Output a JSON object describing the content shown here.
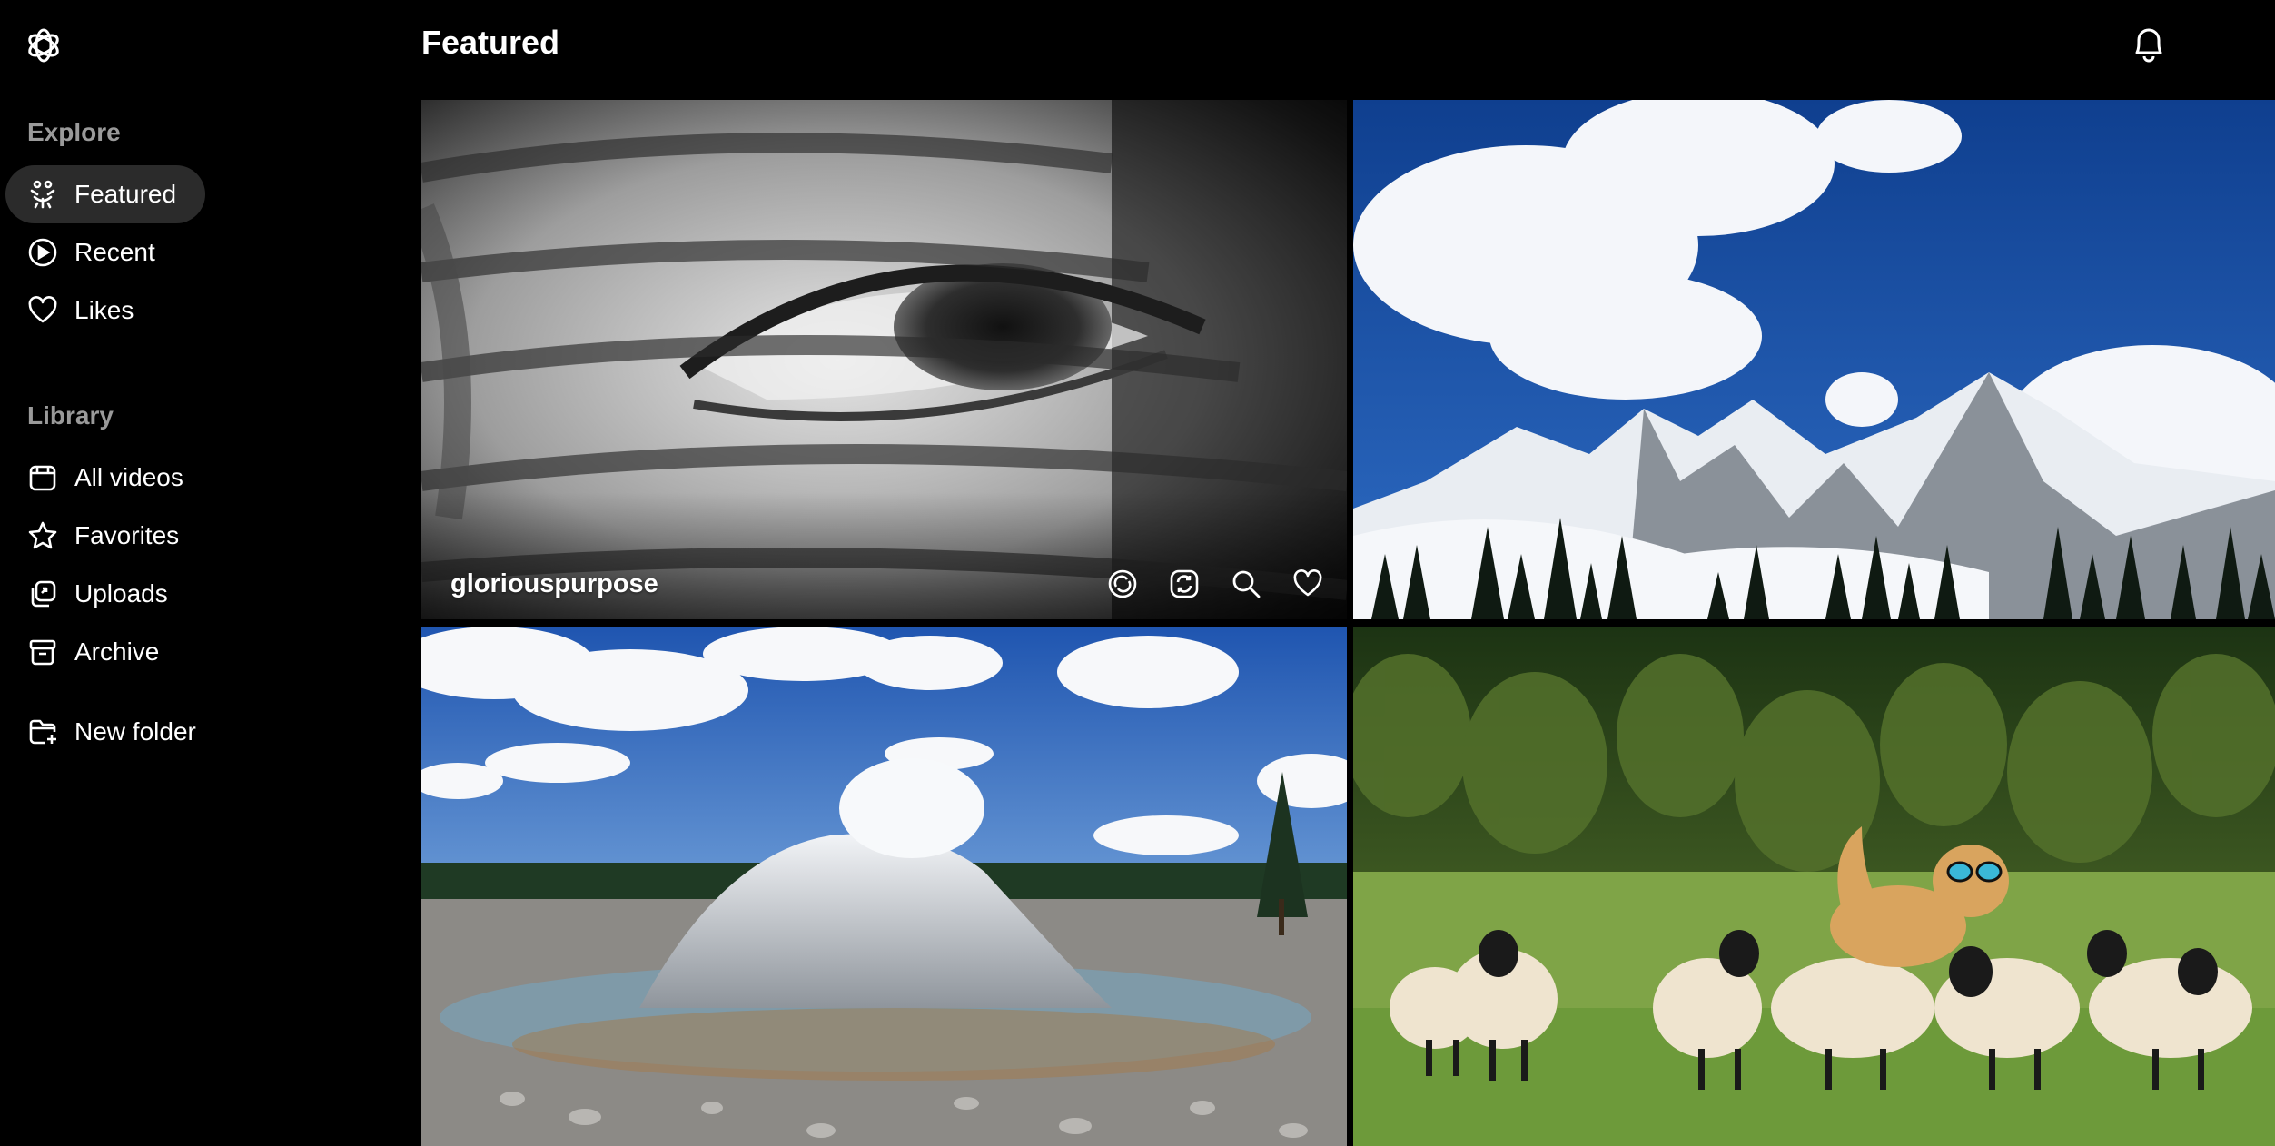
{
  "header": {
    "title": "Featured"
  },
  "sidebar": {
    "explore_label": "Explore",
    "explore_items": [
      {
        "label": "Featured",
        "icon": "featured-icon",
        "active": true
      },
      {
        "label": "Recent",
        "icon": "play-circle-icon"
      },
      {
        "label": "Likes",
        "icon": "heart-icon"
      }
    ],
    "library_label": "Library",
    "library_items": [
      {
        "label": "All videos",
        "icon": "calendar-grid-icon"
      },
      {
        "label": "Favorites",
        "icon": "star-icon"
      },
      {
        "label": "Uploads",
        "icon": "upload-icon"
      },
      {
        "label": "Archive",
        "icon": "archive-box-icon"
      }
    ],
    "new_folder_label": "New folder"
  },
  "tiles": [
    {
      "username": "gloriouspurpose",
      "scene": "black-and-white close-up eye with shadows"
    },
    {
      "scene": "snowy mountains under blue sky with clouds"
    },
    {
      "scene": "geyser cone erupting with steam"
    },
    {
      "scene": "dog with sunglasses running with sheep in green field"
    }
  ],
  "colors": {
    "background": "#000000",
    "active_nav": "#2b2b2b",
    "muted_label": "#9a9a9a",
    "text": "#ffffff"
  }
}
